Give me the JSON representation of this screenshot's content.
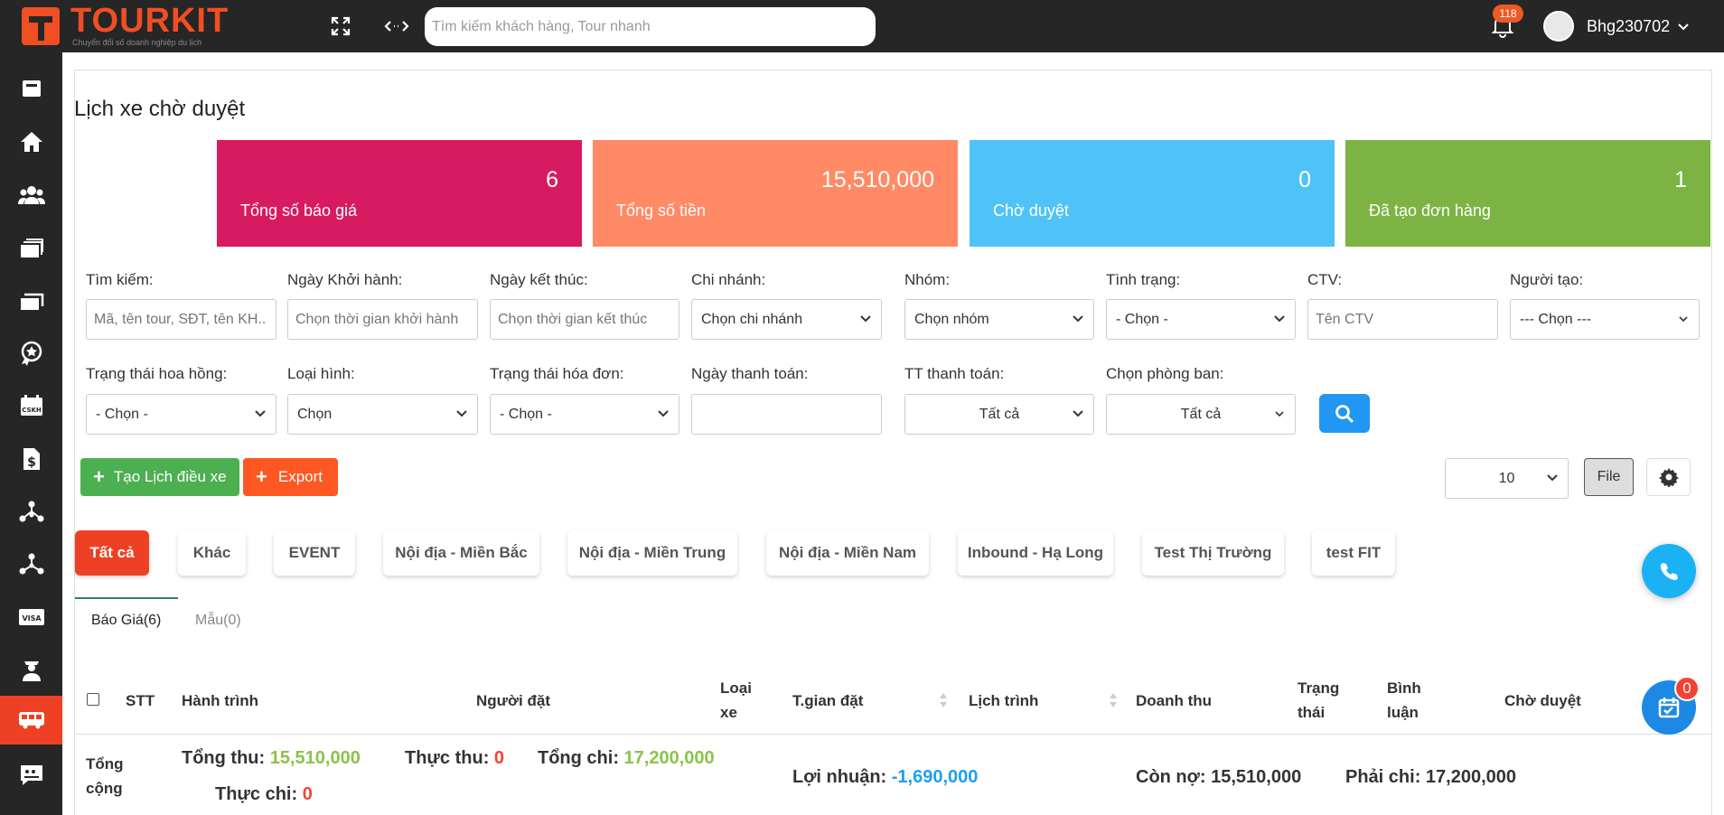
{
  "brand": {
    "name": "TOURKIT",
    "tagline": "Chuyển đổi số doanh nghiệp du lịch",
    "color": "#f04e23"
  },
  "topbar": {
    "search_placeholder": "Tìm kiếm khách hàng, Tour nhanh",
    "notification_count": "118",
    "username": "Bhg230702"
  },
  "sidebar": {
    "items": [
      "book-icon",
      "home-icon",
      "users-icon",
      "folders-icon",
      "copy-icon",
      "star-badge-icon",
      "cskh-calendar-icon",
      "dollar-doc-icon",
      "sitemap-icon",
      "network-icon",
      "visa-icon",
      "driver-icon",
      "bus-icon",
      "chat-icon"
    ],
    "active": "bus-icon"
  },
  "page": {
    "title": "Lịch xe chờ duyệt"
  },
  "cards": [
    {
      "value": "6",
      "label": "Tổng số báo giá",
      "color": "#d81b60"
    },
    {
      "value": "15,510,000",
      "label": "Tổng số tiền",
      "color": "#ff8a65"
    },
    {
      "value": "0",
      "label": "Chờ duyệt",
      "color": "#4fc3f7"
    },
    {
      "value": "1",
      "label": "Đã tạo đơn hàng",
      "color": "#7cb342"
    }
  ],
  "filters": {
    "search": {
      "label": "Tìm kiếm:",
      "placeholder": "Mã, tên tour, SĐT, tên KH.."
    },
    "start_date": {
      "label": "Ngày Khởi hành:",
      "placeholder": "Chọn thời gian khởi hành"
    },
    "end_date": {
      "label": "Ngày kết thúc:",
      "placeholder": "Chọn thời gian kết thúc"
    },
    "branch": {
      "label": "Chi nhánh:",
      "value": "Chọn chi nhánh"
    },
    "group": {
      "label": "Nhóm:",
      "value": "Chọn nhóm"
    },
    "status": {
      "label": "Tình trạng:",
      "value": "- Chọn -"
    },
    "ctv": {
      "label": "CTV:",
      "placeholder": "Tên CTV"
    },
    "creator": {
      "label": "Người tạo:",
      "value": "--- Chọn ---"
    },
    "commission": {
      "label": "Trạng thái hoa hồng:",
      "value": "- Chọn -"
    },
    "type": {
      "label": "Loại hình:",
      "value": "Chọn"
    },
    "invoice": {
      "label": "Trạng thái hóa đơn:",
      "value": "- Chọn -"
    },
    "pay_date": {
      "label": "Ngày thanh toán:",
      "value": ""
    },
    "pay_status": {
      "label": "TT thanh toán:",
      "value": "Tất cả"
    },
    "department": {
      "label": "Chọn phòng ban:",
      "value": "Tất cả"
    }
  },
  "actions": {
    "create_label": "Tạo Lịch điều xe",
    "export_label": "Export",
    "page_size": "10",
    "file_label": "File"
  },
  "tabs": [
    "Tất cả",
    "Khác",
    "EVENT",
    "Nội địa - Miền Bắc",
    "Nội địa - Miền Trung",
    "Nội địa - Miền Nam",
    "Inbound - Hạ Long",
    "Test Thị Trường",
    "test FIT"
  ],
  "subtabs": [
    "Báo Giá(6)",
    "Mẫu(0)"
  ],
  "table": {
    "headers": {
      "stt": "STT",
      "route": "Hành trình",
      "booker": "Người đặt",
      "vehicle_l1": "Loại",
      "vehicle_l2": "xe",
      "booked_time": "T.gian đặt",
      "schedule": "Lịch trình",
      "revenue": "Doanh thu",
      "status_l1": "Trạng",
      "status_l2": "thái",
      "comment_l1": "Bình",
      "comment_l2": "luận",
      "pending": "Chờ duyệt"
    },
    "totals": {
      "label_l1": "Tổng",
      "label_l2": "cộng",
      "income_label": "Tổng thu:",
      "income": "15,510,000",
      "received_label": "Thực thu:",
      "received": "0",
      "expense_label": "Tổng chi:",
      "expense": "17,200,000",
      "paid_label": "Thực chi:",
      "paid": "0",
      "profit_label": "Lợi nhuận:",
      "profit": "-1,690,000",
      "debt_label": "Còn nợ:",
      "debt": "15,510,000",
      "payable_label": "Phải chi:",
      "payable": "17,200,000"
    }
  },
  "floating": {
    "calendar_count": "0"
  }
}
